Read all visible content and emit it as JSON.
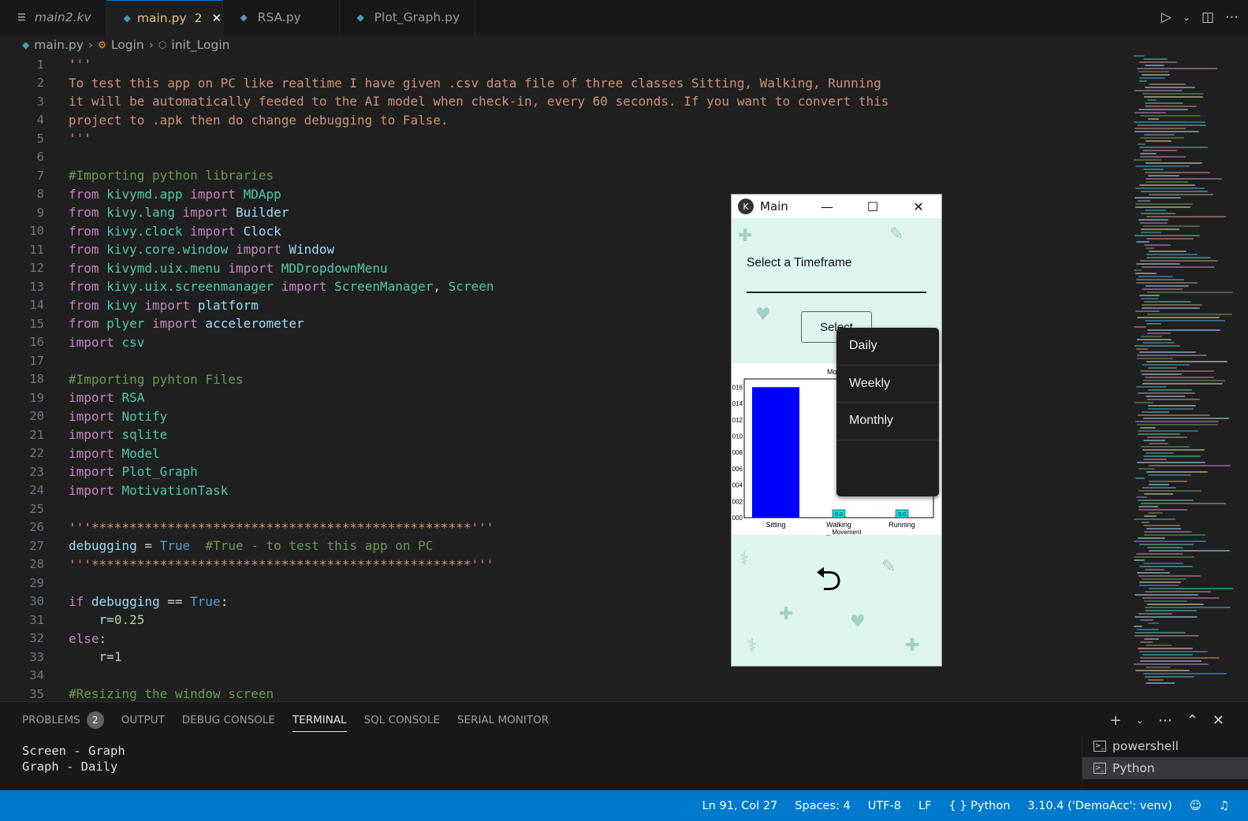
{
  "tabs": [
    {
      "label": "main2.kv",
      "icon": "kv-file-icon",
      "active": false
    },
    {
      "label": "main.py",
      "icon": "python-icon",
      "active": true,
      "badge": "2"
    },
    {
      "label": "RSA.py",
      "icon": "python-icon",
      "active": false
    },
    {
      "label": "Plot_Graph.py",
      "icon": "python-icon",
      "active": false
    }
  ],
  "breadcrumb": {
    "file": "main.py",
    "cls": "Login",
    "fn": "init_Login"
  },
  "code_lines": [
    {
      "n": "1",
      "html": "<span class='c-str'>'''</span>"
    },
    {
      "n": "2",
      "html": "<span class='c-str'>To test this app on PC like realtime I have given .csv data file of three classes Sitting, Walking, Running</span>"
    },
    {
      "n": "3",
      "html": "<span class='c-str'>it will be automatically feeded to the AI model when check-in, every 60 seconds. If you want to convert this</span>"
    },
    {
      "n": "4",
      "html": "<span class='c-str'>project to .apk then do change debugging to False.</span>"
    },
    {
      "n": "5",
      "html": "<span class='c-str'>'''</span>"
    },
    {
      "n": "6",
      "html": ""
    },
    {
      "n": "7",
      "html": "<span class='c-com'>#Importing python libraries</span>"
    },
    {
      "n": "8",
      "html": "<span class='c-kw'>from</span> <span class='c-mod'>kivymd.app</span> <span class='c-kw'>import</span> <span class='c-mod'>MDApp</span>"
    },
    {
      "n": "9",
      "html": "<span class='c-kw'>from</span> <span class='c-mod'>kivy.lang</span> <span class='c-kw'>import</span> <span class='c-var'>Builder</span>"
    },
    {
      "n": "10",
      "html": "<span class='c-kw'>from</span> <span class='c-mod'>kivy.clock</span> <span class='c-kw'>import</span> <span class='c-var'>Clock</span>"
    },
    {
      "n": "11",
      "html": "<span class='c-kw'>from</span> <span class='c-mod'>kivy.core.window</span> <span class='c-kw'>import</span> <span class='c-var'>Window</span>"
    },
    {
      "n": "12",
      "html": "<span class='c-kw'>from</span> <span class='c-mod'>kivymd.uix.menu</span> <span class='c-kw'>import</span> <span class='c-mod'>MDDropdownMenu</span>"
    },
    {
      "n": "13",
      "html": "<span class='c-kw'>from</span> <span class='c-mod'>kivy.uix.screenmanager</span> <span class='c-kw'>import</span> <span class='c-mod'>ScreenManager</span><span class='c-def'>, </span><span class='c-mod'>Screen</span>"
    },
    {
      "n": "14",
      "html": "<span class='c-kw'>from</span> <span class='c-mod'>kivy</span> <span class='c-kw'>import</span> <span class='c-var'>platform</span>"
    },
    {
      "n": "15",
      "html": "<span class='c-kw'>from</span> <span class='c-mod'>plyer</span> <span class='c-kw'>import</span> <span class='c-var'>accelerometer</span>"
    },
    {
      "n": "16",
      "html": "<span class='c-kw'>import</span> <span class='c-mod'>csv</span>"
    },
    {
      "n": "17",
      "html": ""
    },
    {
      "n": "18",
      "html": "<span class='c-com'>#Importing pyhton Files</span>"
    },
    {
      "n": "19",
      "html": "<span class='c-kw'>import</span> <span class='c-mod'>RSA</span>"
    },
    {
      "n": "20",
      "html": "<span class='c-kw'>import</span> <span class='c-mod'>Notify</span>"
    },
    {
      "n": "21",
      "html": "<span class='c-kw'>import</span> <span class='c-mod'>sqlite</span>"
    },
    {
      "n": "22",
      "html": "<span class='c-kw'>import</span> <span class='c-mod'>Model</span>"
    },
    {
      "n": "23",
      "html": "<span class='c-kw'>import</span> <span class='c-mod'>Plot_Graph</span>"
    },
    {
      "n": "24",
      "html": "<span class='c-kw'>import</span> <span class='c-mod'>MotivationTask</span>"
    },
    {
      "n": "25",
      "html": ""
    },
    {
      "n": "26",
      "html": "<span class='c-str'>'''**************************************************'''</span>"
    },
    {
      "n": "27",
      "html": "<span class='c-var'>debugging</span> <span class='c-def'>=</span> <span class='c-const'>True</span>  <span class='c-com'>#True - to test this app on PC</span>"
    },
    {
      "n": "28",
      "html": "<span class='c-str'>'''**************************************************'''</span>"
    },
    {
      "n": "29",
      "html": ""
    },
    {
      "n": "30",
      "html": "<span class='c-kw'>if</span> <span class='c-var'>debugging</span> <span class='c-def'>==</span> <span class='c-const'>True</span><span class='c-def'>:</span>"
    },
    {
      "n": "31",
      "html": "    <span class='c-var'>r</span><span class='c-def'>=</span><span class='c-num'>0.25</span>"
    },
    {
      "n": "32",
      "html": "<span class='c-kw'>else</span><span class='c-def'>:</span>"
    },
    {
      "n": "33",
      "html": "    <span class='c-var'>r</span><span class='c-def'>=</span><span class='c-num'>1</span>"
    },
    {
      "n": "34",
      "html": ""
    },
    {
      "n": "35",
      "html": "<span class='c-com'>#Resizing the window screen</span>"
    }
  ],
  "kivy_window": {
    "title": "Main",
    "heading": "Select a Timeframe",
    "select_label": "Select",
    "menu_items": [
      "Daily",
      "Weekly",
      "Monthly",
      ""
    ]
  },
  "chart_data": {
    "type": "bar",
    "title": "Movement A",
    "xlabel": "Movement",
    "categories": [
      "Sitting",
      "Walking",
      "Running"
    ],
    "values": [
      0.016,
      0.0,
      0.0
    ],
    "data_labels": [
      "",
      "0.0",
      "0.0"
    ],
    "yticks": [
      ".016",
      ".014",
      ".012",
      ".010",
      ".008",
      ".006",
      ".004",
      ".002",
      ".000"
    ],
    "ylim": [
      0,
      0.017
    ],
    "bar_colors": [
      "#0000ff",
      "#00e5e5",
      "#00e5e5"
    ]
  },
  "panel": {
    "tabs": [
      {
        "label": "PROBLEMS",
        "count": "2"
      },
      {
        "label": "OUTPUT"
      },
      {
        "label": "DEBUG CONSOLE"
      },
      {
        "label": "TERMINAL",
        "active": true
      },
      {
        "label": "SQL CONSOLE"
      },
      {
        "label": "SERIAL MONITOR"
      }
    ],
    "terminal_lines": [
      "Screen - Graph",
      "Graph - Daily"
    ],
    "terminals": [
      {
        "label": "powershell",
        "active": false
      },
      {
        "label": "Python",
        "active": true
      }
    ]
  },
  "status": {
    "position": "Ln 91, Col 27",
    "spaces": "Spaces: 4",
    "encoding": "UTF-8",
    "eol": "LF",
    "language": "Python",
    "interpreter": "3.10.4 ('DemoAcc': venv)"
  }
}
